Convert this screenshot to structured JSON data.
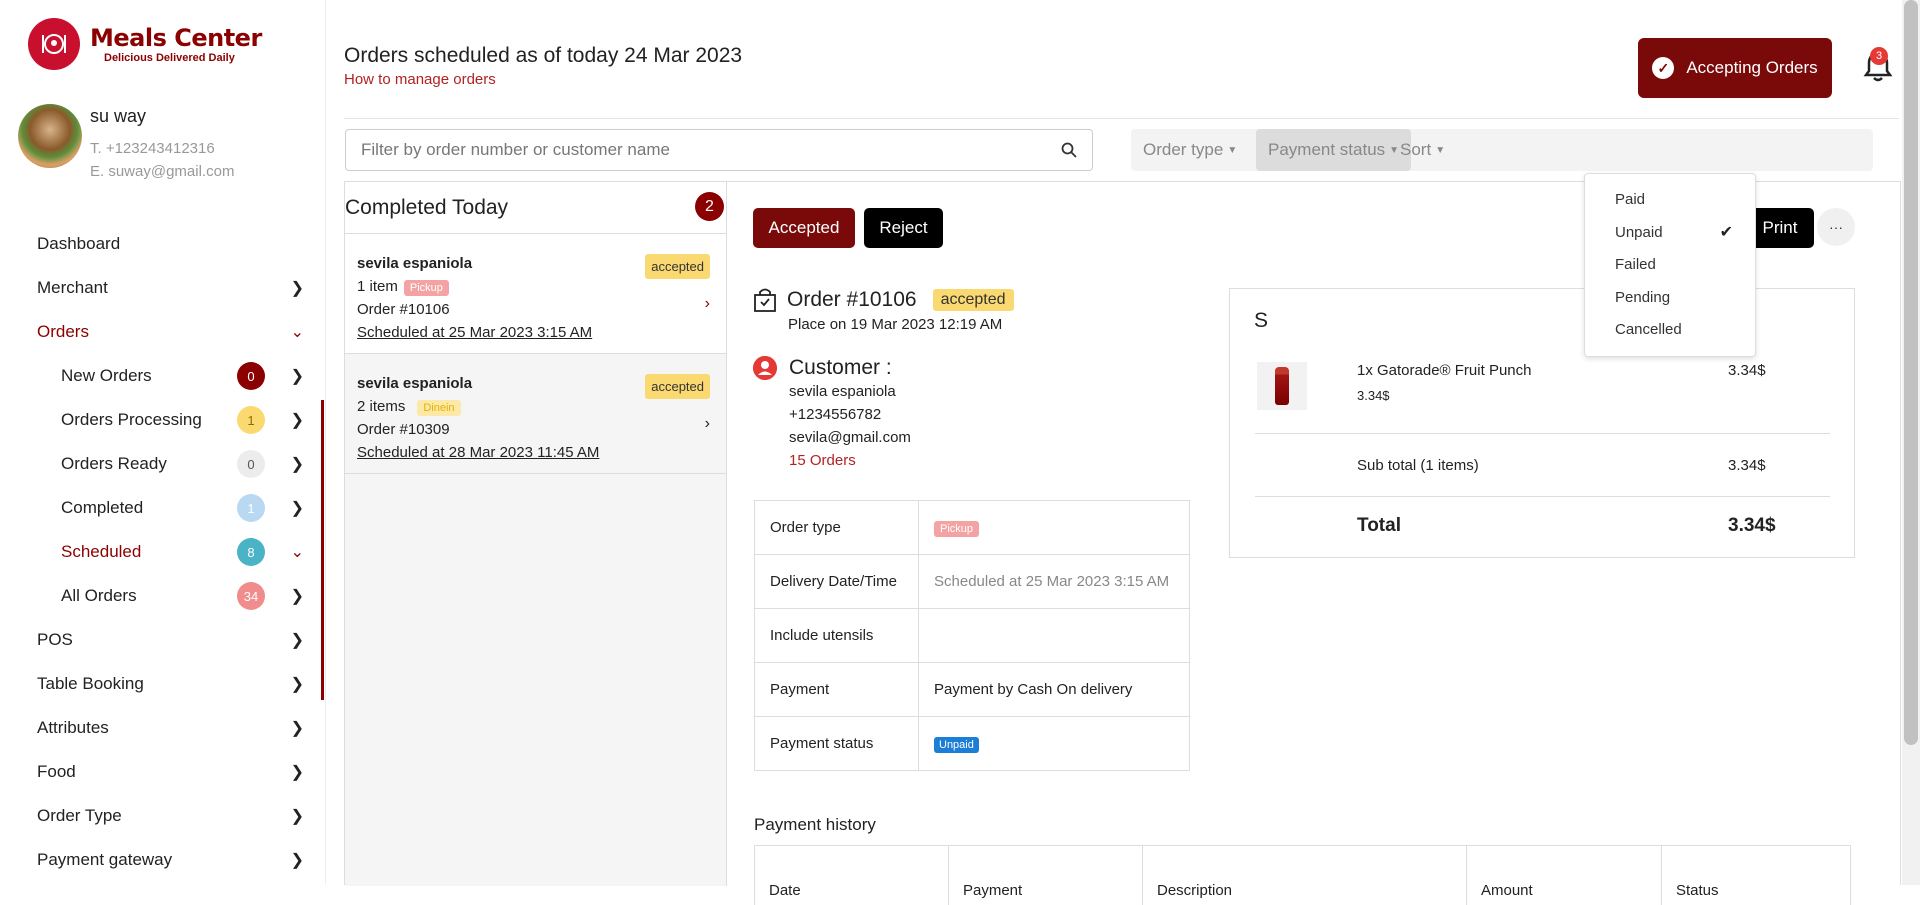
{
  "brand": {
    "name": "Meals Center",
    "tagline": "Delicious Delivered Daily",
    "color": "#8b0000"
  },
  "user": {
    "name": "su way",
    "phone": "T. +123243412316",
    "email": "E. suway@gmail.com"
  },
  "sidebar": {
    "items": [
      {
        "label": "Dashboard"
      },
      {
        "label": "Merchant"
      },
      {
        "label": "Orders"
      },
      {
        "label": "New Orders",
        "count": "0",
        "badge_color": "#8b0000",
        "badge_text_color": "#ffffff"
      },
      {
        "label": "Orders Processing",
        "count": "1",
        "badge_color": "#fbd971",
        "badge_text_color": "#8a6d00"
      },
      {
        "label": "Orders Ready",
        "count": "0",
        "badge_color": "#ececec",
        "badge_text_color": "#555555"
      },
      {
        "label": "Completed",
        "count": "1",
        "badge_color": "#b9d9f2",
        "badge_text_color": "#ffffff"
      },
      {
        "label": "Scheduled",
        "count": "8",
        "badge_color": "#4ab3c6",
        "badge_text_color": "#ffffff"
      },
      {
        "label": "All Orders",
        "count": "34",
        "badge_color": "#f08c8c",
        "badge_text_color": "#ffffff"
      },
      {
        "label": "POS"
      },
      {
        "label": "Table Booking"
      },
      {
        "label": "Attributes"
      },
      {
        "label": "Food"
      },
      {
        "label": "Order Type"
      },
      {
        "label": "Payment gateway"
      }
    ]
  },
  "header": {
    "title": "Orders scheduled as of today 24 Mar 2023",
    "manage_link": "How to manage orders",
    "accepting_label": "Accepting Orders",
    "notif_count": "3"
  },
  "search": {
    "placeholder": "Filter by order number or customer name"
  },
  "filters": {
    "order_type": "Order type",
    "payment_status": "Payment status",
    "sort": "Sort"
  },
  "payment_dropdown": {
    "options": [
      "Paid",
      "Unpaid",
      "Failed",
      "Pending",
      "Cancelled"
    ],
    "selected": "Unpaid"
  },
  "list": {
    "title": "Completed Today",
    "count": "2",
    "orders": [
      {
        "customer": "sevila espaniola",
        "status": "accepted",
        "items": "1 item",
        "type": "Pickup",
        "number": "Order #10106",
        "scheduled": "Scheduled at 25 Mar 2023 3:15 AM"
      },
      {
        "customer": "sevila espaniola",
        "status": "accepted",
        "items": "2 items",
        "type": "Dinein",
        "number": "Order #10309",
        "scheduled": "Scheduled at 28 Mar 2023 11:45 AM"
      }
    ]
  },
  "detail": {
    "accepted_label": "Accepted",
    "reject_label": "Reject",
    "print_label": "Print",
    "more_label": "···",
    "order_number": "Order #10106",
    "status": "accepted",
    "placed": "Place on 19 Mar 2023 12:19 AM",
    "customer_title": "Customer :",
    "customer_name": "sevila espaniola",
    "customer_phone": "+1234556782",
    "customer_email": "sevila@gmail.com",
    "customer_orders": "15 Orders",
    "info": {
      "order_type_label": "Order type",
      "order_type_value": "Pickup",
      "delivery_label": "Delivery Date/Time",
      "delivery_value": "Scheduled at 25 Mar 2023 3:15 AM",
      "utensils_label": "Include utensils",
      "utensils_value": "",
      "payment_label": "Payment",
      "payment_value": "Payment by Cash On delivery",
      "payment_status_label": "Payment status",
      "payment_status_value": "Unpaid"
    },
    "payment_history_title": "Payment history",
    "payment_history_columns": [
      "Date",
      "Payment",
      "Description",
      "Amount",
      "Status"
    ]
  },
  "summary": {
    "heading_initial": "S",
    "item_name": "1x Gatorade® Fruit Punch",
    "item_unit_price": "3.34$",
    "item_total": "3.34$",
    "subtotal_label": "Sub total (1 items)",
    "subtotal_value": "3.34$",
    "total_label": "Total",
    "total_value": "3.34$"
  }
}
